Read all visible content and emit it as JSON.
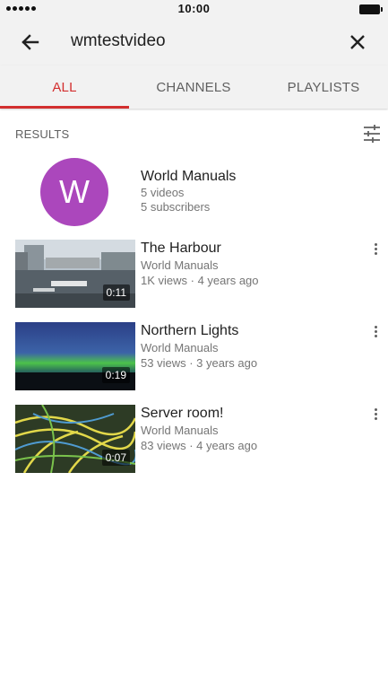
{
  "status_bar": {
    "time": "10:00"
  },
  "search": {
    "query": "wmtestvideo"
  },
  "tabs": [
    {
      "label": "ALL",
      "active": true
    },
    {
      "label": "CHANNELS",
      "active": false
    },
    {
      "label": "PLAYLISTS",
      "active": false
    }
  ],
  "results": {
    "label": "RESULTS",
    "channel": {
      "initial": "W",
      "name": "World Manuals",
      "videos": "5 videos",
      "subscribers": "5 subscribers",
      "avatar_color": "#ab47bc"
    },
    "videos": [
      {
        "title": "The Harbour",
        "channel": "World Manuals",
        "stats": "1K views · 4 years ago",
        "duration": "0:11"
      },
      {
        "title": "Northern Lights",
        "channel": "World Manuals",
        "stats": "53 views · 3 years ago",
        "duration": "0:19"
      },
      {
        "title": "Server room!",
        "channel": "World Manuals",
        "stats": "83 views · 4 years ago",
        "duration": "0:07"
      }
    ]
  },
  "colors": {
    "accent": "#d32f2f",
    "app_bar": "#f2f2f2"
  },
  "icons": [
    "back-arrow-icon",
    "close-icon",
    "filter-sliders-icon",
    "more-vertical-icon"
  ]
}
